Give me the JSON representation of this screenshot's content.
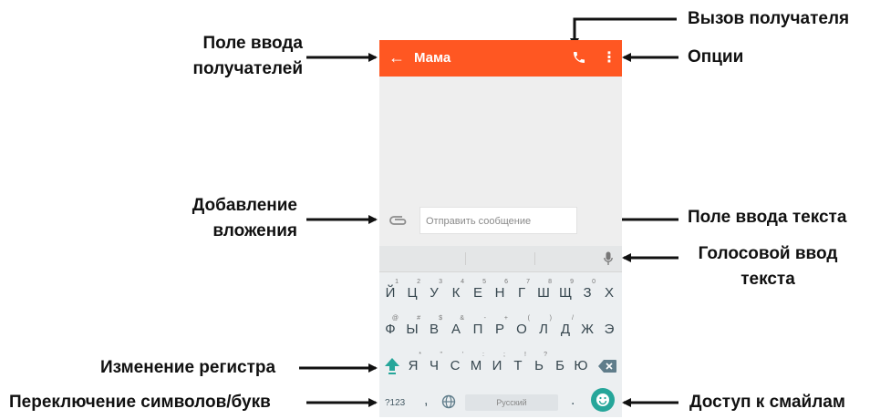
{
  "callouts": {
    "recipients_field": "Поле ввода\nполучателей",
    "call_recipient": "Вызов получателя",
    "options": "Опции",
    "add_attachment": "Добавление\nвложения",
    "text_field": "Поле ввода текста",
    "voice_input": "Голосовой ввод\nтекста",
    "shift": "Изменение регистра",
    "symbols_switch": "Переключение символов/букв",
    "emoji_access": "Доступ к смайлам"
  },
  "appbar": {
    "back_glyph": "←",
    "title": "Мама",
    "more_glyph": "⋮"
  },
  "compose": {
    "placeholder": "Отправить сообщение"
  },
  "keyboard": {
    "row1": [
      "Й",
      "Ц",
      "У",
      "К",
      "Е",
      "Н",
      "Г",
      "Ш",
      "Щ",
      "З",
      "Х"
    ],
    "row1_hints": [
      "1",
      "2",
      "3",
      "4",
      "5",
      "6",
      "7",
      "8",
      "9",
      "0",
      ""
    ],
    "row2": [
      "Ф",
      "Ы",
      "В",
      "А",
      "П",
      "Р",
      "О",
      "Л",
      "Д",
      "Ж",
      "Э"
    ],
    "row2_hints": [
      "@",
      "#",
      "$",
      "&",
      "-",
      "+",
      "(",
      ")",
      "/",
      "",
      ""
    ],
    "row3": [
      "Я",
      "Ч",
      "С",
      "М",
      "И",
      "Т",
      "Ь",
      "Б",
      "Ю"
    ],
    "row3_hints": [
      "*",
      "\"",
      "'",
      ":",
      ";",
      "!",
      "?",
      "",
      ""
    ],
    "symbols_label": "?123",
    "comma": ",",
    "space_label": "Русский",
    "period": "."
  },
  "colors": {
    "accent": "#ff5722",
    "emoji": "#26a69a",
    "shift": "#26a69a"
  },
  "icons": [
    "back-arrow-icon",
    "phone-icon",
    "more-vert-icon",
    "paperclip-icon",
    "mic-icon",
    "shift-icon",
    "backspace-icon",
    "globe-icon",
    "emoji-icon"
  ]
}
